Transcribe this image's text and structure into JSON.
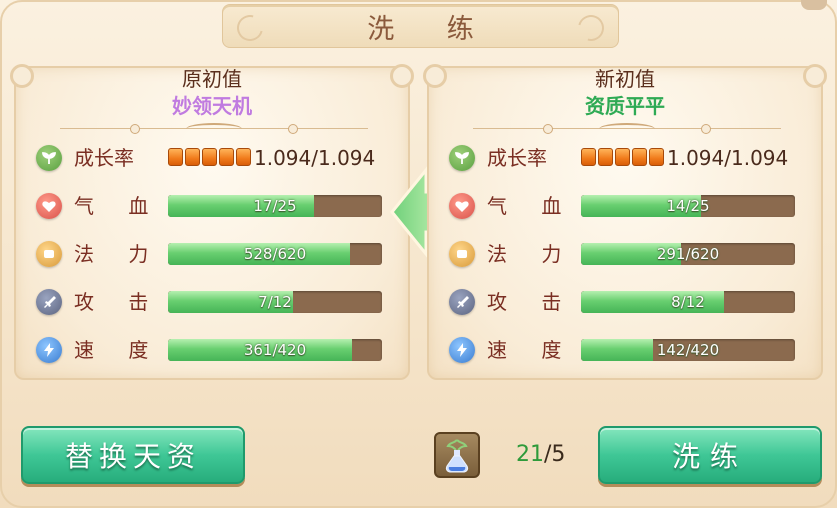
{
  "title": "洗 练",
  "left_panel": {
    "heading": "原初值",
    "quality": "妙领天机",
    "growth": {
      "label": "成长率",
      "stars": 5,
      "value": "1.094/1.094"
    },
    "stats": [
      {
        "key": "hp",
        "label": "气 血",
        "value": "17/25",
        "current": 17,
        "max": 25
      },
      {
        "key": "mp",
        "label": "法 力",
        "value": "528/620",
        "current": 528,
        "max": 620
      },
      {
        "key": "atk",
        "label": "攻 击",
        "value": "7/12",
        "current": 7,
        "max": 12
      },
      {
        "key": "spd",
        "label": "速 度",
        "value": "361/420",
        "current": 361,
        "max": 420
      }
    ]
  },
  "right_panel": {
    "heading": "新初值",
    "quality": "资质平平",
    "growth": {
      "label": "成长率",
      "stars": 5,
      "value": "1.094/1.094"
    },
    "stats": [
      {
        "key": "hp",
        "label": "气 血",
        "value": "14/25",
        "current": 14,
        "max": 25
      },
      {
        "key": "mp",
        "label": "法 力",
        "value": "291/620",
        "current": 291,
        "max": 620
      },
      {
        "key": "atk",
        "label": "攻 击",
        "value": "8/12",
        "current": 8,
        "max": 12
      },
      {
        "key": "spd",
        "label": "速 度",
        "value": "142/420",
        "current": 142,
        "max": 420
      }
    ]
  },
  "buttons": {
    "replace": "替换天资",
    "refine": "洗练"
  },
  "item": {
    "icon": "potion-bottle-icon",
    "have": "21",
    "need": "/5"
  },
  "colors": {
    "quality_left": "#c07be0",
    "quality_right": "#2eaa54",
    "bar_fill": "#45b457",
    "button": "#3fc796"
  }
}
